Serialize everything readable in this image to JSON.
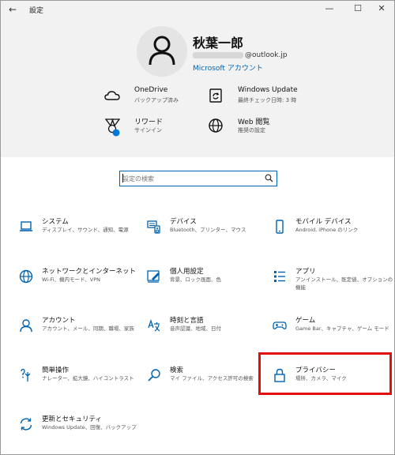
{
  "titlebar": {
    "title": "設定",
    "minimize": "—",
    "maximize": "☐",
    "close": "✕",
    "back": "←"
  },
  "account": {
    "name": "秋葉一郎",
    "email_suffix": "@outlook.jp",
    "link": "Microsoft アカウント"
  },
  "status": [
    {
      "id": "onedrive",
      "title": "OneDrive",
      "subtitle": "バックアップ済み",
      "icon": "cloud-icon"
    },
    {
      "id": "windows-update",
      "title": "Windows Update",
      "subtitle": "最終チェック日時: 3 時",
      "icon": "update-icon"
    },
    {
      "id": "rewards",
      "title": "リワード",
      "subtitle": "サインイン",
      "icon": "rewards-icon"
    },
    {
      "id": "web-browsing",
      "title": "Web 閲覧",
      "subtitle": "推奨の設定",
      "icon": "globe-icon"
    }
  ],
  "search": {
    "placeholder": "設定の検索"
  },
  "categories": [
    {
      "id": "system",
      "title": "システム",
      "desc": "ディスプレイ、サウンド、通知、電源",
      "icon": "laptop-icon"
    },
    {
      "id": "devices",
      "title": "デバイス",
      "desc": "Bluetooth、プリンター、マウス",
      "icon": "keyboard-icon"
    },
    {
      "id": "mobile",
      "title": "モバイル デバイス",
      "desc": "Android, iPhone のリンク",
      "icon": "phone-icon"
    },
    {
      "id": "network",
      "title": "ネットワークとインターネット",
      "desc": "Wi-Fi、機内モード、VPN",
      "icon": "globe-icon"
    },
    {
      "id": "personalization",
      "title": "個人用設定",
      "desc": "背景、ロック画面、色",
      "icon": "paint-icon"
    },
    {
      "id": "apps",
      "title": "アプリ",
      "desc": "アンインストール、既定値、オプションの機能",
      "icon": "apps-icon"
    },
    {
      "id": "accounts",
      "title": "アカウント",
      "desc": "アカウント、メール、同期、職場、家族",
      "icon": "person-icon"
    },
    {
      "id": "time-language",
      "title": "時刻と言語",
      "desc": "音声認識、地域、日付",
      "icon": "language-icon"
    },
    {
      "id": "gaming",
      "title": "ゲーム",
      "desc": "Game Bar、キャプチャ、ゲーム モード",
      "icon": "gamepad-icon"
    },
    {
      "id": "ease-of-access",
      "title": "簡単操作",
      "desc": "ナレーター、拡大鏡、ハイコントラスト",
      "icon": "ease-of-access-icon"
    },
    {
      "id": "search",
      "title": "検索",
      "desc": "マイ ファイル、アクセス許可の検索",
      "icon": "search-icon"
    },
    {
      "id": "privacy",
      "title": "プライバシー",
      "desc": "場所、カメラ、マイク",
      "icon": "lock-icon"
    },
    {
      "id": "update-security",
      "title": "更新とセキュリティ",
      "desc": "Windows Update、回復、バックアップ",
      "icon": "sync-icon"
    }
  ],
  "colors": {
    "accent": "#0063b1",
    "highlight": "#e10e0e",
    "header_bg": "#f2f2f2"
  }
}
